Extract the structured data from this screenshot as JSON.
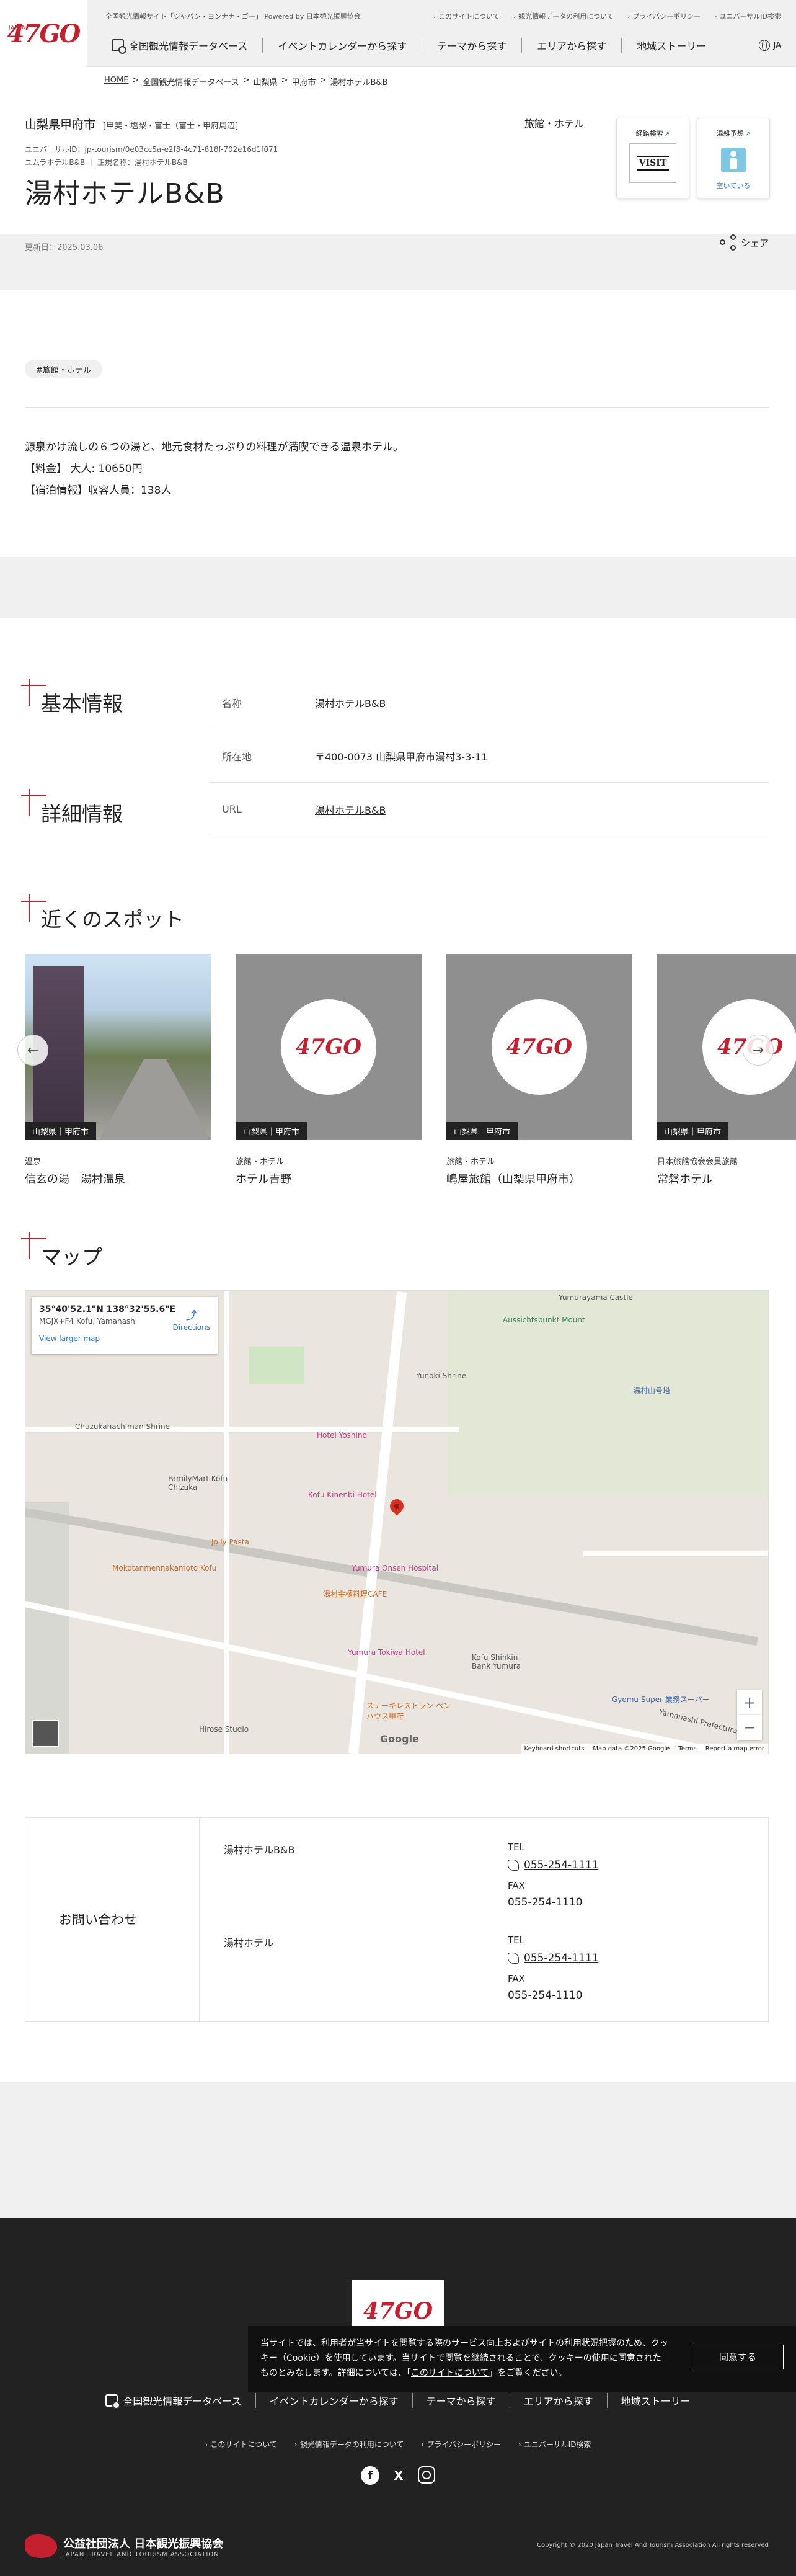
{
  "header": {
    "logo": "47GO",
    "logo_small": "JAPAN",
    "tagline": "全国観光情報サイト「ジャパン・ヨンナナ・ゴー」 Powered by 日本観光振興協会",
    "toplinks": [
      "このサイトについて",
      "観光情報データの利用について",
      "プライバシーポリシー",
      "ユニバーサルID検索"
    ],
    "nav": [
      "全国観光情報データベース",
      "イベントカレンダーから探す",
      "テーマから探す",
      "エリアから探す",
      "地域ストーリー"
    ],
    "lang": "JA"
  },
  "breadcrumb": [
    "HOME",
    "全国観光情報データベース",
    "山梨県",
    "甲府市",
    "湯村ホテルB&B"
  ],
  "spot": {
    "region": "山梨県甲府市",
    "region_sub": "[甲斐・塩梨・富士（富士・甲府周辺]",
    "genre": "旅館・ホテル",
    "universal_id": "ユニバーサルID：jp-tourism/0e03cc5a-e2f8-4c71-818f-702e16d1f071",
    "alias": "ユムラホテルB&B ｜ 正規名称：湯村ホテルB&B",
    "title": "湯村ホテルB&B",
    "updated": "更新日：2025.03.06",
    "share": "シェア",
    "badge1_title": "経路検索",
    "badge1_logo": "VISIT",
    "badge2_title": "混雑予想",
    "badge2_caption": "空いている",
    "tag": "#旅館・ホテル",
    "desc": [
      "源泉かけ流しの６つの湯と、地元食材たっぷりの料理が満喫できる温泉ホテル。",
      "【料金】 大人: 10650円",
      "【宿泊情報】収容人員：138人"
    ]
  },
  "basic": {
    "heading": "基本情報",
    "rows": [
      {
        "k": "名称",
        "v": "湯村ホテルB&B"
      },
      {
        "k": "所在地",
        "v": "〒400-0073 山梨県甲府市湯村3-3-11"
      }
    ]
  },
  "detail": {
    "heading": "詳細情報",
    "rows": [
      {
        "k": "URL",
        "v": "湯村ホテルB&B"
      }
    ]
  },
  "nearby": {
    "heading": "近くのスポット",
    "cards": [
      {
        "label": "山梨県｜甲府市",
        "cat": "温泉",
        "name": "信玄の湯　湯村温泉"
      },
      {
        "label": "山梨県｜甲府市",
        "cat": "旅館・ホテル",
        "name": "ホテル吉野"
      },
      {
        "label": "山梨県｜甲府市",
        "cat": "旅館・ホテル",
        "name": "嶋屋旅館（山梨県甲府市）"
      },
      {
        "label": "山梨県｜甲府市",
        "cat": "日本旅館協会会員旅館",
        "name": "常磐ホテル"
      }
    ]
  },
  "map": {
    "heading": "マップ",
    "coords": "35°40'52.1\"N 138°32'55.6\"E",
    "address": "MGJX+F4 Kofu, Yamanashi",
    "larger": "View larger map",
    "directions": "Directions",
    "labels": [
      {
        "t": "Yumurayama Castle",
        "c": ""
      },
      {
        "t": "Aussichtspunkt Mount",
        "c": ""
      },
      {
        "t": "Yunoki Shrine",
        "c": ""
      },
      {
        "t": "湯村山号塔",
        "c": "blue"
      },
      {
        "t": "Chuzukahachiman Shrine",
        "c": ""
      },
      {
        "t": "FamilyMart Kofu Chizuka",
        "c": ""
      },
      {
        "t": "Hotel Yoshino",
        "c": "poi"
      },
      {
        "t": "Kofu Kinenbi Hotel",
        "c": "poi"
      },
      {
        "t": "Jolly Pasta",
        "c": ""
      },
      {
        "t": "Yumura Onsen Hospital",
        "c": "poi"
      },
      {
        "t": "Mokotanmennakamoto Kofu",
        "c": ""
      },
      {
        "t": "湯村金櫃料理CAFE",
        "c": ""
      },
      {
        "t": "Yumura Tokiwa Hotel",
        "c": "poi"
      },
      {
        "t": "Kofu Shinkin Bank Yumura",
        "c": ""
      },
      {
        "t": "Gyomu Super 業務スーパー",
        "c": "blue"
      },
      {
        "t": "Hirose Studio",
        "c": ""
      },
      {
        "t": "ステーキレストラン ペンハウス甲府",
        "c": ""
      },
      {
        "t": "Yamanashi Prefectural Rd",
        "c": ""
      }
    ],
    "attribution": [
      "Keyboard shortcuts",
      "Map data ©2025 Google",
      "Terms",
      "Report a map error"
    ],
    "google": "Google"
  },
  "contact": {
    "title": "お問い合わせ",
    "entries": [
      {
        "name": "湯村ホテルB&B",
        "tel_label": "TEL",
        "tel": "055-254-1111",
        "fax_label": "FAX",
        "fax": "055-254-1110"
      },
      {
        "name": "湯村ホテル",
        "tel_label": "TEL",
        "tel": "055-254-1111",
        "fax_label": "FAX",
        "fax": "055-254-1110"
      }
    ]
  },
  "footer": {
    "logo": "47GO",
    "nav": [
      "全国観光情報データベース",
      "イベントカレンダーから探す",
      "テーマから探す",
      "エリアから探す",
      "地域ストーリー"
    ],
    "sub": [
      "このサイトについて",
      "観光情報データの利用について",
      "プライバシーポリシー",
      "ユニバーサルID検索"
    ],
    "social": [
      "f",
      "X"
    ],
    "org": "公益社団法人 日本観光振興協会",
    "org_en": "JAPAN TRAVEL AND TOURISM ASSOCIATION",
    "copyright": "Copyright © 2020 Japan Travel And Tourism Association All rights reserved"
  },
  "cookie": {
    "text1": "当サイトでは、利用者が当サイトを閲覧する際のサービス向上およびサイトの利用状況把握のため、クッキー（Cookie）を使用しています。当サイトで閲覧を継続されることで、クッキーの使用に同意されたものとみなします。詳細については、「",
    "link": "このサイトについて",
    "text2": "」をご覧ください。",
    "agree": "同意する"
  }
}
